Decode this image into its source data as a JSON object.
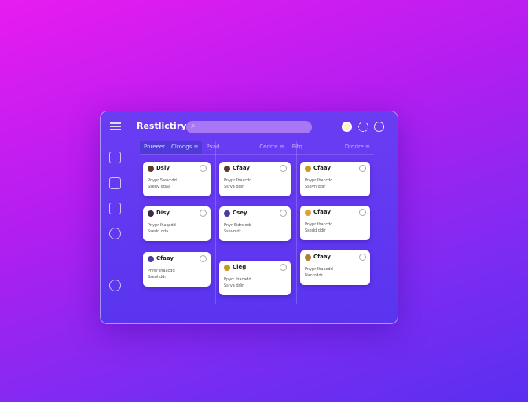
{
  "app": {
    "title": "Restlictiry",
    "search_placeholder": "⌕"
  },
  "header_icons": [
    "avatar",
    "share-icon",
    "refresh-icon"
  ],
  "sidebar": {
    "icons": [
      "calendar-icon",
      "document-icon",
      "clipboard-icon",
      "settings-icon",
      "info-icon"
    ]
  },
  "tabs": [
    {
      "label": "Pnreeer",
      "extra": "Clroqgs ≡"
    },
    {
      "label": "Pyad",
      "extra": "Cedrre ≡"
    },
    {
      "label": "Pitq",
      "extra": "Drddre ≡"
    }
  ],
  "columns": [
    {
      "cards": [
        {
          "title": "Dsiy",
          "line1": "Pnypr Sasvcdd",
          "line2": "Ssenv ddaa",
          "avatar_color": "#5b3a2a"
        },
        {
          "title": "Disy",
          "line1": "Pnypr Ihaqcdd",
          "line2": "Ssedd dda",
          "avatar_color": "#3a2a4a"
        },
        {
          "title": "Cfaay",
          "line1": "Pnrer Ihaacdd",
          "line2": "Ssenl ddr",
          "avatar_color": "#4a3aa0"
        }
      ]
    },
    {
      "cards": [
        {
          "title": "Cfaay",
          "line1": "Pnypr Ihaccdd",
          "line2": "Ssrva ddir",
          "avatar_color": "#5b3a2a"
        },
        {
          "title": "Csey",
          "line1": "Pnyr Sidrs ddr",
          "line2": "Ssevrcdr",
          "avatar_color": "#4a3aa0"
        },
        {
          "title": "Cleg",
          "line1": "Ppyrr Ihacadd",
          "line2": "Ssrva ddir",
          "avatar_color": "#c89a20"
        }
      ]
    },
    {
      "cards": [
        {
          "title": "Cfaay",
          "line1": "Pnypr Ihaccdd",
          "line2": "Ssevn ddir",
          "avatar_color": "#c89a20"
        },
        {
          "title": "Cfaay",
          "line1": "Pnypr Ihaccdd",
          "line2": "Ssedd ddir",
          "avatar_color": "#e0a030"
        },
        {
          "title": "Cfaay",
          "line1": "Pnypr Ihaacdd",
          "line2": "Naccrddr",
          "avatar_color": "#b08030"
        }
      ]
    }
  ]
}
